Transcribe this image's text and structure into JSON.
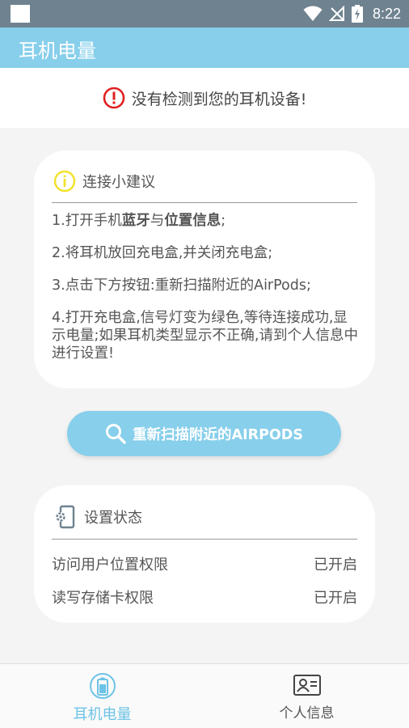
{
  "status_bar": {
    "time": "8:22"
  },
  "app_bar": {
    "title": "耳机电量"
  },
  "alert": {
    "text": "没有检测到您的耳机设备!"
  },
  "tips_card": {
    "title": "连接小建议",
    "tip1_a": "1.打开手机",
    "tip1_b": "蓝牙",
    "tip1_c": "与",
    "tip1_d": "位置信息",
    "tip1_e": ";",
    "tip2": "2.将耳机放回充电盒,并关闭充电盒;",
    "tip3": "3.点击下方按钮:重新扫描附近的AirPods;",
    "tip4": "4.打开充电盒,信号灯变为绿色,等待连接成功,显示电量;如果耳机类型显示不正确,请到个人信息中进行设置!"
  },
  "rescan_button": {
    "label": "重新扫描附近的AIRPODS"
  },
  "status_card": {
    "title": "设置状态",
    "rows": [
      {
        "label": "访问用户位置权限",
        "value": "已开启"
      },
      {
        "label": "读写存储卡权限",
        "value": "已开启"
      }
    ]
  },
  "bottom_nav": {
    "items": [
      {
        "label": "耳机电量",
        "icon": "battery-icon",
        "active": true
      },
      {
        "label": "个人信息",
        "icon": "id-card-icon",
        "active": false
      }
    ]
  },
  "colors": {
    "accent": "#87cfeb",
    "alert": "#e02020",
    "tip_icon": "#f2e22a"
  }
}
